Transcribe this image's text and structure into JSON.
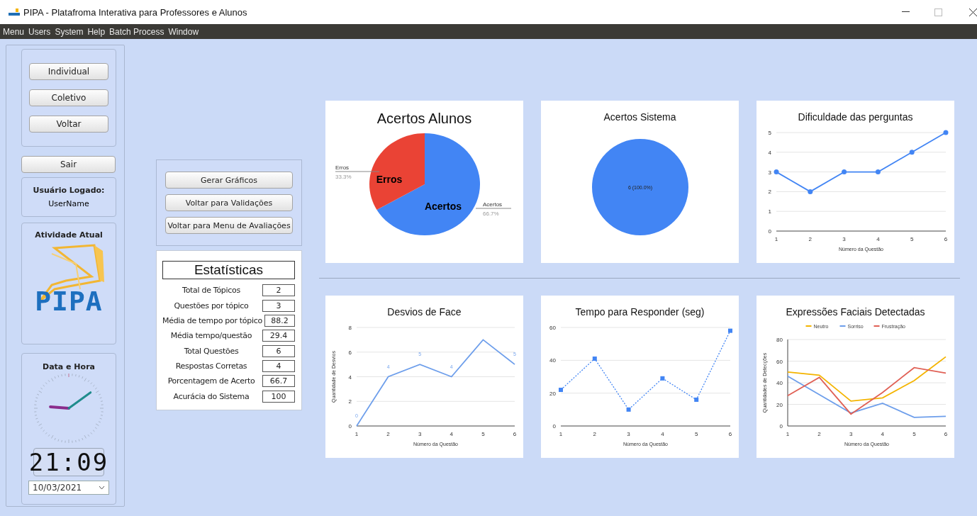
{
  "window": {
    "title": "PIPA - Platafroma Interativa para Professores e Alunos"
  },
  "menu": [
    "Menu",
    "Users",
    "System",
    "Help",
    "Batch Process",
    "Window"
  ],
  "sidebar": {
    "nav_buttons": [
      "Individual",
      "Coletivo",
      "Voltar"
    ],
    "exit_button": "Sair",
    "user": {
      "heading": "Usuário Logado:",
      "name": "UserName"
    },
    "activity": {
      "heading": "Atividade Atual",
      "logo_text": "PIPA"
    },
    "datetime": {
      "heading": "Data e Hora",
      "time": "21:09",
      "date": "10/03/2021"
    }
  },
  "actions": [
    "Gerar Gráficos",
    "Voltar para Validações",
    "Voltar para Menu de Avaliações"
  ],
  "statistics": {
    "title": "Estatísticas",
    "rows": [
      {
        "label": "Total de Tópicos",
        "value": "2"
      },
      {
        "label": "Questões por tópico",
        "value": "3"
      },
      {
        "label": "Média de tempo por tópico",
        "value": "88.2"
      },
      {
        "label": "Média tempo/questão",
        "value": "29.4"
      },
      {
        "label": "Total Questões",
        "value": "6"
      },
      {
        "label": "Respostas Corretas",
        "value": "4"
      },
      {
        "label": "Porcentagem de Acerto",
        "value": "66.7"
      },
      {
        "label": "Acurácia do Sistema",
        "value": "100"
      }
    ]
  },
  "charts": [
    {
      "chart_data": {
        "type": "pie",
        "title": "Acertos Alunos",
        "categories": [
          "Acertos",
          "Erros"
        ],
        "values": [
          66.7,
          33.3
        ],
        "value_labels": [
          "66.7%",
          "33.3%"
        ],
        "annotations": [
          {
            "text": "Acertos"
          },
          {
            "text": "Erros"
          }
        ]
      }
    },
    {
      "chart_data": {
        "type": "pie",
        "title": "Acertos Sistema",
        "values": [
          6
        ],
        "value_labels": [
          "6 (100.0%)"
        ]
      }
    },
    {
      "chart_data": {
        "type": "line",
        "title": "Dificuldade das perguntas",
        "xlabel": "Número da Questão",
        "categories": [
          "1",
          "2",
          "3",
          "4",
          "5",
          "6"
        ],
        "ylim": [
          0,
          5
        ],
        "yticks": [
          0,
          1,
          2,
          3,
          4,
          5
        ],
        "grid": true,
        "series": [
          {
            "color": "#4285f4",
            "marker": "circle",
            "line_style": "solid",
            "values": [
              3,
              2,
              3,
              3,
              4,
              5
            ]
          }
        ]
      }
    },
    {
      "chart_data": {
        "type": "line",
        "title": "Desvios de Face",
        "xlabel": "Número da Questão",
        "ylabel": "Quantidade de Desvios",
        "categories": [
          "1",
          "2",
          "3",
          "4",
          "5",
          "6"
        ],
        "ylim": [
          0,
          8
        ],
        "yticks": [
          0,
          2,
          4,
          6,
          8
        ],
        "grid": true,
        "series": [
          {
            "color": "#6d9eeb",
            "marker": "none",
            "line_style": "solid",
            "values": [
              0,
              4,
              5,
              4,
              7,
              5
            ],
            "value_labels": [
              "0",
              "4",
              "5",
              "4",
              null,
              "5"
            ]
          }
        ]
      }
    },
    {
      "chart_data": {
        "type": "line",
        "title": "Tempo para Responder (seg)",
        "xlabel": "Número da Questão",
        "categories": [
          "1",
          "2",
          "3",
          "4",
          "5",
          "6"
        ],
        "ylim": [
          0,
          60
        ],
        "yticks": [
          0,
          20,
          40,
          60
        ],
        "grid": true,
        "series": [
          {
            "color": "#4285f4",
            "marker": "square",
            "line_style": "dotted",
            "values": [
              22,
              41,
              10,
              29,
              16,
              58
            ]
          }
        ]
      }
    },
    {
      "chart_data": {
        "type": "line",
        "title": "Expressões Faciais Detectadas",
        "xlabel": "Número da Questão",
        "ylabel": "Quantidades de Detecções",
        "categories": [
          "1",
          "2",
          "3",
          "4",
          "5",
          "6"
        ],
        "ylim": [
          0,
          80
        ],
        "yticks": [
          0,
          20,
          40,
          60,
          80
        ],
        "grid": true,
        "legend": "top",
        "series": [
          {
            "name": "Neutro",
            "color": "#f4b400",
            "marker": "none",
            "line_style": "solid",
            "values": [
              50,
              47,
              23,
              26,
              42,
              64
            ]
          },
          {
            "name": "Sorriso",
            "color": "#6d9eeb",
            "marker": "none",
            "line_style": "solid",
            "values": [
              46,
              29,
              12,
              21,
              8,
              9
            ]
          },
          {
            "name": "Frustração",
            "color": "#e06055",
            "marker": "none",
            "line_style": "solid",
            "values": [
              28,
              45,
              11,
              31,
              54,
              49
            ]
          }
        ]
      }
    }
  ]
}
